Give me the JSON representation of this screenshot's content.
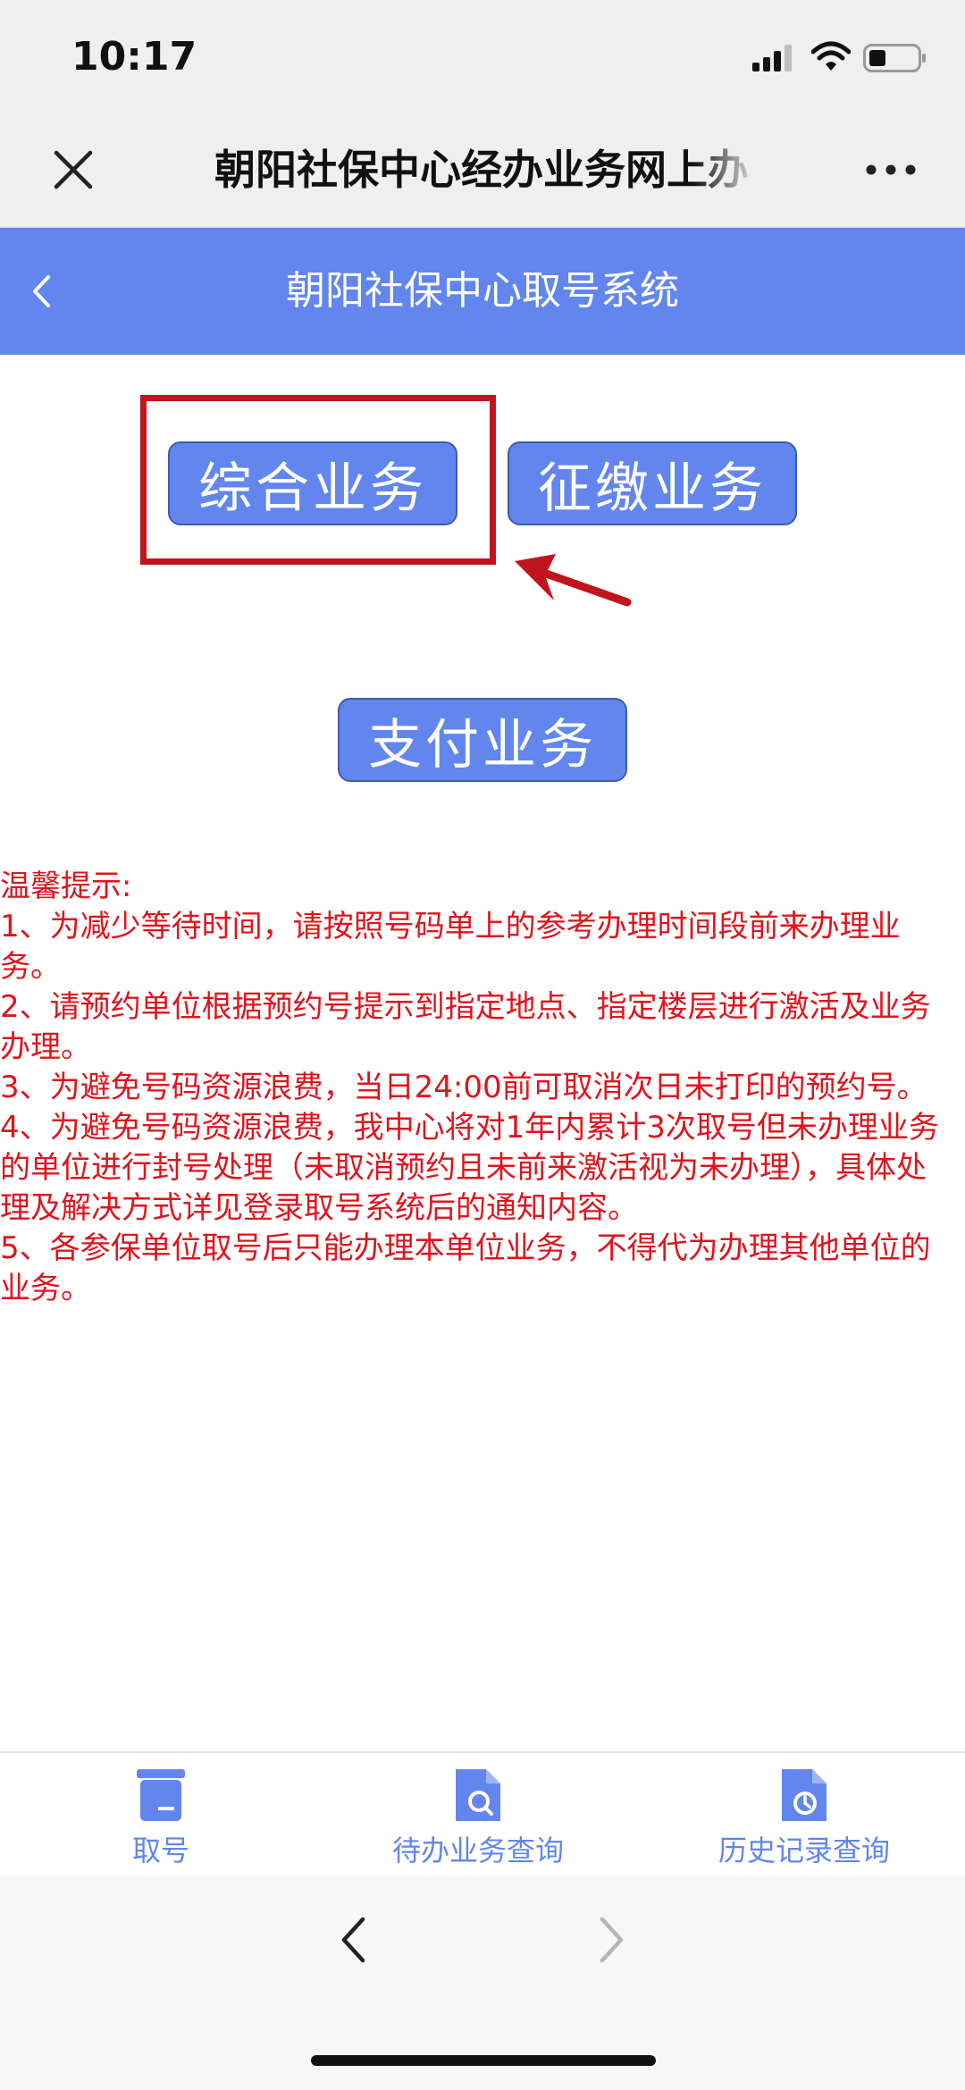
{
  "status_bar": {
    "time": "10:17"
  },
  "wechat_header": {
    "title": "朝阳社保中心经办业务网上办"
  },
  "app_bar": {
    "title": "朝阳社保中心取号系统"
  },
  "services": {
    "comprehensive": "综合业务",
    "collection": "征缴业务",
    "payment": "支付业务"
  },
  "notice": {
    "heading": "温馨提示:",
    "items": [
      "1、为减少等待时间，请按照号码单上的参考办理时间段前来办理业务。",
      "2、请预约单位根据预约号提示到指定地点、指定楼层进行激活及业务办理。",
      "3、为避免号码资源浪费，当日24:00前可取消次日未打印的预约号。",
      "4、为避免号码资源浪费，我中心将对1年内累计3次取号但未办理业务的单位进行封号处理（未取消预约且未前来激活视为未办理），具体处理及解决方式详见登录取号系统后的通知内容。",
      "5、各参保单位取号后只能办理本单位业务，不得代为办理其他单位的业务。"
    ]
  },
  "bottom_nav": {
    "take_number": "取号",
    "pending_query": "待办业务查询",
    "history_query": "历史记录查询"
  },
  "colors": {
    "primary": "#6286ee",
    "notice_red": "#e0141d",
    "highlight_red": "#c0151f"
  },
  "icons": {
    "close": "close-icon",
    "more": "more-icon",
    "back": "chevron-left-icon",
    "take_number": "ticket-printer-icon",
    "pending": "document-search-icon",
    "history": "document-clock-icon"
  }
}
